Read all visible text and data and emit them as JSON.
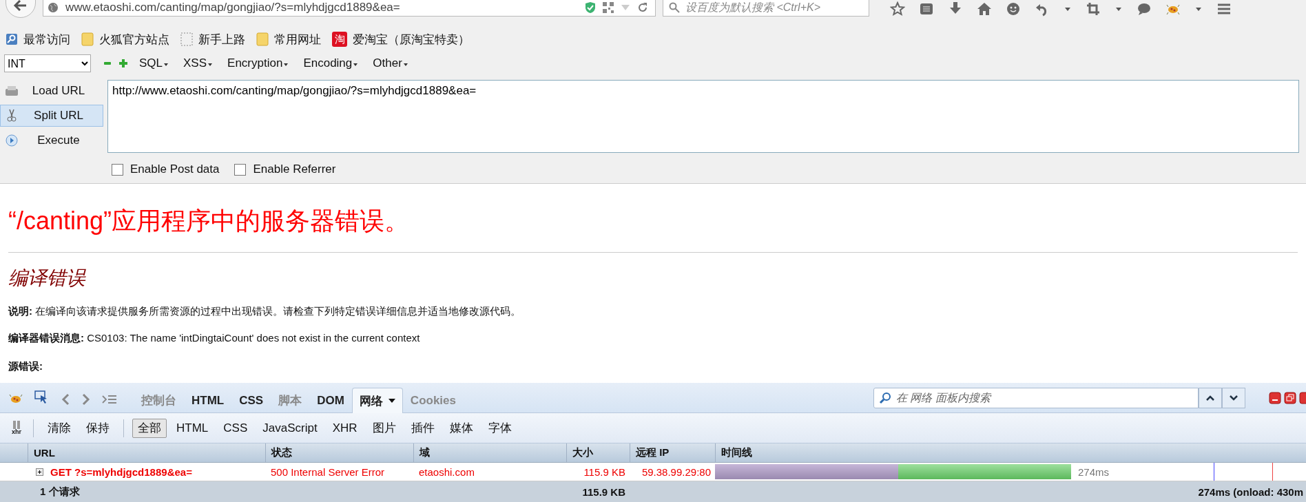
{
  "address_bar": {
    "url": "www.etaoshi.com/canting/map/gongjiao/?s=mlyhdjgcd1889&ea=",
    "search_placeholder": "设百度为默认搜索 <Ctrl+K>"
  },
  "bookmarks": [
    {
      "label": "最常访问",
      "kind": "smart"
    },
    {
      "label": "火狐官方站点",
      "kind": "folder"
    },
    {
      "label": "新手上路",
      "kind": "dashed"
    },
    {
      "label": "常用网址",
      "kind": "folder"
    },
    {
      "label": "爱淘宝（原淘宝特卖）",
      "kind": "badge",
      "badge_text": "淘"
    }
  ],
  "hackbar": {
    "select": "INT",
    "menus": [
      "SQL",
      "XSS",
      "Encryption",
      "Encoding",
      "Other"
    ],
    "actions": [
      {
        "label": "Load URL",
        "kind": "load",
        "selected": false
      },
      {
        "label": "Split URL",
        "kind": "split",
        "selected": true
      },
      {
        "label": "Execute",
        "kind": "execute",
        "selected": false
      }
    ],
    "url_text": "http://www.etaoshi.com/canting/map/gongjiao/?s=mlyhdjgcd1889&ea=",
    "options": [
      {
        "label": "Enable Post data",
        "checked": false
      },
      {
        "label": "Enable Referrer",
        "checked": false
      }
    ]
  },
  "page": {
    "title": "“/canting”应用程序中的服务器错误。",
    "subtitle": "编译错误",
    "paragraphs": [
      {
        "label": "说明:",
        "text": "在编译向该请求提供服务所需资源的过程中出现错误。请检查下列特定错误详细信息并适当地修改源代码。"
      },
      {
        "label": "编译器错误消息:",
        "text": "CS0103: The name 'intDingtaiCount' does not exist in the current context"
      }
    ],
    "source_label": "源错误:"
  },
  "devtools": {
    "tabs": [
      {
        "label": "控制台",
        "selected": false,
        "disabled": true
      },
      {
        "label": "HTML",
        "selected": false,
        "disabled": false
      },
      {
        "label": "CSS",
        "selected": false,
        "disabled": false
      },
      {
        "label": "脚本",
        "selected": false,
        "disabled": true
      },
      {
        "label": "DOM",
        "selected": false,
        "disabled": false
      },
      {
        "label": "网络",
        "selected": true,
        "disabled": false
      },
      {
        "label": "Cookies",
        "selected": false,
        "disabled": true
      }
    ],
    "search_placeholder": "在 网络 面板内搜索",
    "persist_icon_label": "xhr",
    "actions": [
      "清除",
      "保持"
    ],
    "filters": [
      {
        "label": "全部",
        "selected": true
      },
      {
        "label": "HTML",
        "selected": false
      },
      {
        "label": "CSS",
        "selected": false
      },
      {
        "label": "JavaScript",
        "selected": false
      },
      {
        "label": "XHR",
        "selected": false
      },
      {
        "label": "图片",
        "selected": false
      },
      {
        "label": "插件",
        "selected": false
      },
      {
        "label": "媒体",
        "selected": false
      },
      {
        "label": "字体",
        "selected": false
      }
    ],
    "columns": [
      "URL",
      "状态",
      "域",
      "大小",
      "远程 IP",
      "时间线"
    ],
    "rows": [
      {
        "url": "GET ?s=mlyhdjgcd1889&ea=",
        "status": "500 Internal Server Error",
        "domain": "etaoshi.com",
        "size": "115.9 KB",
        "remote_ip": "59.38.99.29:80",
        "timing": "274ms",
        "expanded": false
      }
    ],
    "footer": {
      "count": "1 个请求",
      "size": "115.9 KB",
      "timing": "274ms (onload: 430m"
    }
  }
}
